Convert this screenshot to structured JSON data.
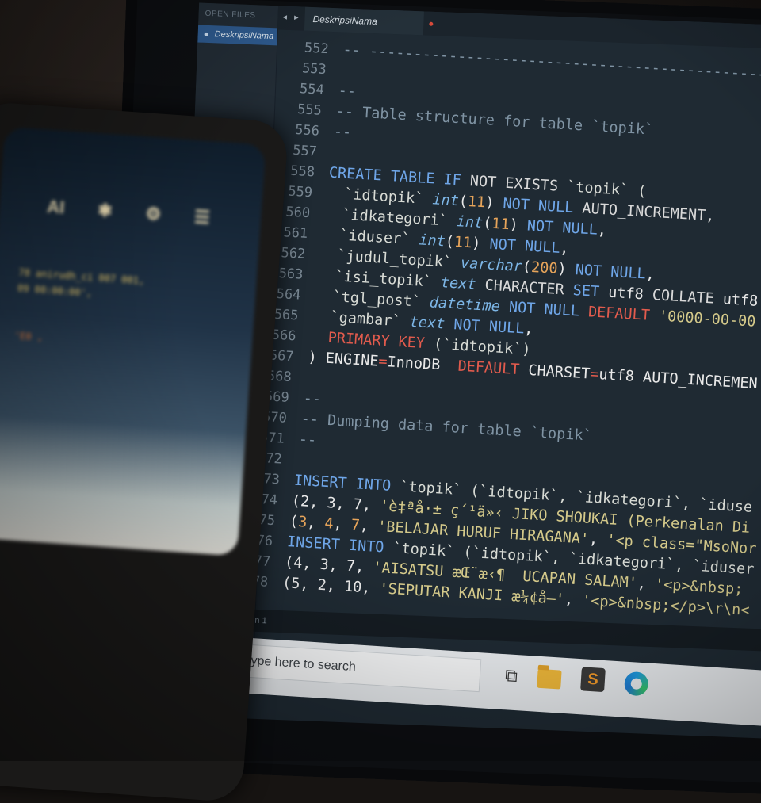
{
  "sidebar": {
    "heading": "OPEN FILES",
    "file": "DeskripsiNama"
  },
  "tabbar": {
    "arrows": "◂ ▸",
    "tab": "DeskripsiNama"
  },
  "code_lines": [
    {
      "n": "552",
      "segs": [
        {
          "c": "c-com",
          "t": "-- -----------------------------------------------"
        }
      ]
    },
    {
      "n": "553",
      "segs": []
    },
    {
      "n": "554",
      "segs": [
        {
          "c": "c-com",
          "t": "--"
        }
      ]
    },
    {
      "n": "555",
      "segs": [
        {
          "c": "c-com",
          "t": "-- Table structure for table `topik`"
        }
      ]
    },
    {
      "n": "556",
      "segs": [
        {
          "c": "c-com",
          "t": "--"
        }
      ]
    },
    {
      "n": "557",
      "segs": []
    },
    {
      "n": "558",
      "segs": [
        {
          "c": "c-kw",
          "t": "CREATE TABLE IF "
        },
        {
          "c": "c-kw2",
          "t": "NOT EXISTS "
        },
        {
          "c": "c-id",
          "t": "`topik` ("
        }
      ]
    },
    {
      "n": "559",
      "segs": [
        {
          "c": "c-id",
          "t": "  `idtopik` "
        },
        {
          "c": "c-ty",
          "t": "int"
        },
        {
          "c": "c-pl",
          "t": "("
        },
        {
          "c": "c-num",
          "t": "11"
        },
        {
          "c": "c-pl",
          "t": ") "
        },
        {
          "c": "c-kw",
          "t": "NOT NULL "
        },
        {
          "c": "c-kw2",
          "t": "AUTO_INCREMENT,"
        }
      ]
    },
    {
      "n": "560",
      "segs": [
        {
          "c": "c-id",
          "t": "  `idkategori` "
        },
        {
          "c": "c-ty",
          "t": "int"
        },
        {
          "c": "c-pl",
          "t": "("
        },
        {
          "c": "c-num",
          "t": "11"
        },
        {
          "c": "c-pl",
          "t": ") "
        },
        {
          "c": "c-kw",
          "t": "NOT NULL"
        },
        {
          "c": "c-pl",
          "t": ","
        }
      ]
    },
    {
      "n": "561",
      "segs": [
        {
          "c": "c-id",
          "t": "  `iduser` "
        },
        {
          "c": "c-ty",
          "t": "int"
        },
        {
          "c": "c-pl",
          "t": "("
        },
        {
          "c": "c-num",
          "t": "11"
        },
        {
          "c": "c-pl",
          "t": ") "
        },
        {
          "c": "c-kw",
          "t": "NOT NULL"
        },
        {
          "c": "c-pl",
          "t": ","
        }
      ]
    },
    {
      "n": "562",
      "segs": [
        {
          "c": "c-id",
          "t": "  `judul_topik` "
        },
        {
          "c": "c-ty",
          "t": "varchar"
        },
        {
          "c": "c-pl",
          "t": "("
        },
        {
          "c": "c-num",
          "t": "200"
        },
        {
          "c": "c-pl",
          "t": ") "
        },
        {
          "c": "c-kw",
          "t": "NOT NULL"
        },
        {
          "c": "c-pl",
          "t": ","
        }
      ]
    },
    {
      "n": "563",
      "segs": [
        {
          "c": "c-id",
          "t": "  `isi_topik` "
        },
        {
          "c": "c-ty",
          "t": "text "
        },
        {
          "c": "c-kw2",
          "t": "CHARACTER "
        },
        {
          "c": "c-kw",
          "t": "SET "
        },
        {
          "c": "c-pl",
          "t": "utf8 "
        },
        {
          "c": "c-kw2",
          "t": "COLLATE "
        },
        {
          "c": "c-pl",
          "t": "utf8"
        }
      ]
    },
    {
      "n": "564",
      "segs": [
        {
          "c": "c-id",
          "t": "  `tgl_post` "
        },
        {
          "c": "c-ty",
          "t": "datetime "
        },
        {
          "c": "c-kw",
          "t": "NOT NULL "
        },
        {
          "c": "c-red",
          "t": "DEFAULT "
        },
        {
          "c": "c-str",
          "t": "'0000-00-00"
        }
      ]
    },
    {
      "n": "565",
      "segs": [
        {
          "c": "c-id",
          "t": "  `gambar` "
        },
        {
          "c": "c-ty",
          "t": "text "
        },
        {
          "c": "c-kw",
          "t": "NOT NULL"
        },
        {
          "c": "c-pl",
          "t": ","
        }
      ]
    },
    {
      "n": "566",
      "segs": [
        {
          "c": "c-red",
          "t": "  PRIMARY KEY "
        },
        {
          "c": "c-id",
          "t": "(`idtopik`)"
        }
      ]
    },
    {
      "n": "567",
      "segs": [
        {
          "c": "c-pl",
          "t": ") ENGINE"
        },
        {
          "c": "c-red",
          "t": "="
        },
        {
          "c": "c-pl",
          "t": "InnoDB  "
        },
        {
          "c": "c-red",
          "t": "DEFAULT "
        },
        {
          "c": "c-pl",
          "t": "CHARSET"
        },
        {
          "c": "c-red",
          "t": "="
        },
        {
          "c": "c-pl",
          "t": "utf8 AUTO_INCREMEN"
        }
      ]
    },
    {
      "n": "568",
      "segs": []
    },
    {
      "n": "569",
      "segs": [
        {
          "c": "c-com",
          "t": "--"
        }
      ]
    },
    {
      "n": "570",
      "segs": [
        {
          "c": "c-com",
          "t": "-- Dumping data for table `topik`"
        }
      ]
    },
    {
      "n": "571",
      "segs": [
        {
          "c": "c-com",
          "t": "--"
        }
      ]
    },
    {
      "n": "572",
      "segs": []
    },
    {
      "n": "573",
      "segs": [
        {
          "c": "c-kw",
          "t": "INSERT INTO "
        },
        {
          "c": "c-id",
          "t": "`topik` (`idtopik`, `idkategori`, `iduse"
        }
      ]
    },
    {
      "n": "574",
      "segs": [
        {
          "c": "c-pl",
          "t": "(2, 3, 7, "
        },
        {
          "c": "c-str",
          "t": "'è‡ªå·± ç´¹ä»‹ JIKO SHOUKAI (Perkenalan Di"
        }
      ]
    },
    {
      "n": "575",
      "segs": [
        {
          "c": "c-pl",
          "t": "("
        },
        {
          "c": "c-num",
          "t": "3"
        },
        {
          "c": "c-pl",
          "t": ", "
        },
        {
          "c": "c-num",
          "t": "4"
        },
        {
          "c": "c-pl",
          "t": ", "
        },
        {
          "c": "c-num",
          "t": "7"
        },
        {
          "c": "c-pl",
          "t": ", "
        },
        {
          "c": "c-str",
          "t": "'BELAJAR HURUF HIRAGANA'"
        },
        {
          "c": "c-pl",
          "t": ", "
        },
        {
          "c": "c-str",
          "t": "'<p class=\"MsoNor"
        }
      ]
    },
    {
      "n": "576",
      "segs": [
        {
          "c": "c-kw",
          "t": "INSERT INTO "
        },
        {
          "c": "c-id",
          "t": "`topik` (`idtopik`, `idkategori`, `iduser"
        }
      ]
    },
    {
      "n": "577",
      "segs": [
        {
          "c": "c-pl",
          "t": "(4, 3, 7, "
        },
        {
          "c": "c-str",
          "t": "'AISATSU æŒ¨æ‹¶  UCAPAN SALAM'"
        },
        {
          "c": "c-pl",
          "t": ", "
        },
        {
          "c": "c-str",
          "t": "'<p>&nbsp;"
        }
      ]
    },
    {
      "n": "578",
      "segs": [
        {
          "c": "c-pl",
          "t": "(5, 2, 10, "
        },
        {
          "c": "c-str",
          "t": "'SEPUTAR KANJI æ¼¢å—'"
        },
        {
          "c": "c-pl",
          "t": ", "
        },
        {
          "c": "c-str",
          "t": "'<p>&nbsp;</p>\\r\\n<"
        }
      ]
    }
  ],
  "status": "Line 609, Column 1",
  "taskbar": {
    "search_placeholder": "Type here to search",
    "taskview": "⧉",
    "sublime": "S"
  },
  "phone": {
    "icons": [
      "AI",
      "✱",
      "⚙",
      "☰"
    ],
    "lines": [
      "78 anirudh_ci 007 001,",
      "09 00:00:00',",
      "'E0 ,"
    ]
  }
}
